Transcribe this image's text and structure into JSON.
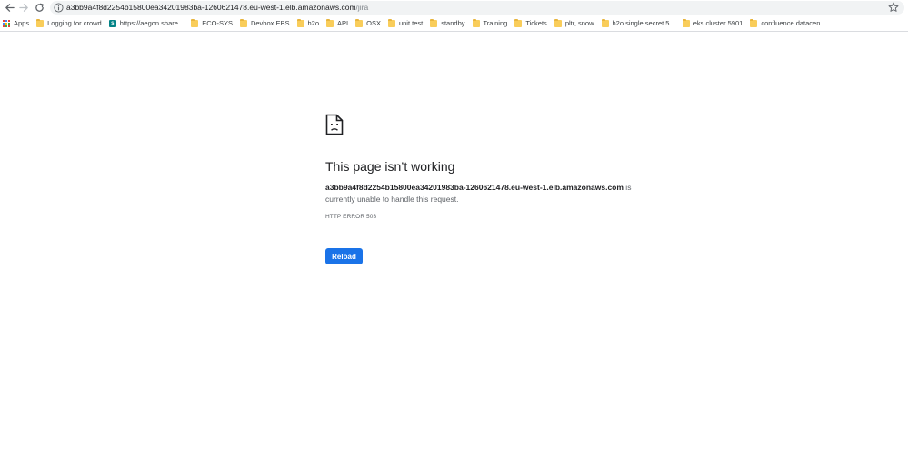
{
  "browser": {
    "url_host": "a3bb9a4f8d2254b15800ea34201983ba-1260621478.eu-west-1.elb.amazonaws.com",
    "url_path": "/jira",
    "colors": {
      "omnibox_bg": "#f1f3f4",
      "folder": "#f9cd5a",
      "button_blue": "#1a73e8"
    }
  },
  "bookmarks": {
    "apps_label": "Apps",
    "items": [
      {
        "label": "Logging for crowd",
        "icon": "folder-icon"
      },
      {
        "label": "https://aegon.share...",
        "icon": "sharepoint-icon"
      },
      {
        "label": "ECO-SYS",
        "icon": "folder-icon"
      },
      {
        "label": "Devbox EBS",
        "icon": "folder-icon"
      },
      {
        "label": "h2o",
        "icon": "folder-icon"
      },
      {
        "label": "API",
        "icon": "folder-icon"
      },
      {
        "label": "OSX",
        "icon": "folder-icon"
      },
      {
        "label": "unit test",
        "icon": "folder-icon"
      },
      {
        "label": "standby",
        "icon": "folder-icon"
      },
      {
        "label": "Training",
        "icon": "folder-icon"
      },
      {
        "label": "Tickets",
        "icon": "folder-icon"
      },
      {
        "label": "pltr, snow",
        "icon": "folder-icon"
      },
      {
        "label": "h2o single secret 5...",
        "icon": "folder-icon"
      },
      {
        "label": "eks cluster 5901",
        "icon": "folder-icon"
      },
      {
        "label": "confluence datacen...",
        "icon": "folder-icon"
      }
    ]
  },
  "error": {
    "icon": "sad-page-icon",
    "title": "This page isn’t working",
    "host": "a3bb9a4f8d2254b15800ea34201983ba-1260621478.eu-west-1.elb.amazonaws.com",
    "message_suffix": " is currently unable to handle this request.",
    "code": "HTTP ERROR 503",
    "reload_label": "Reload"
  }
}
